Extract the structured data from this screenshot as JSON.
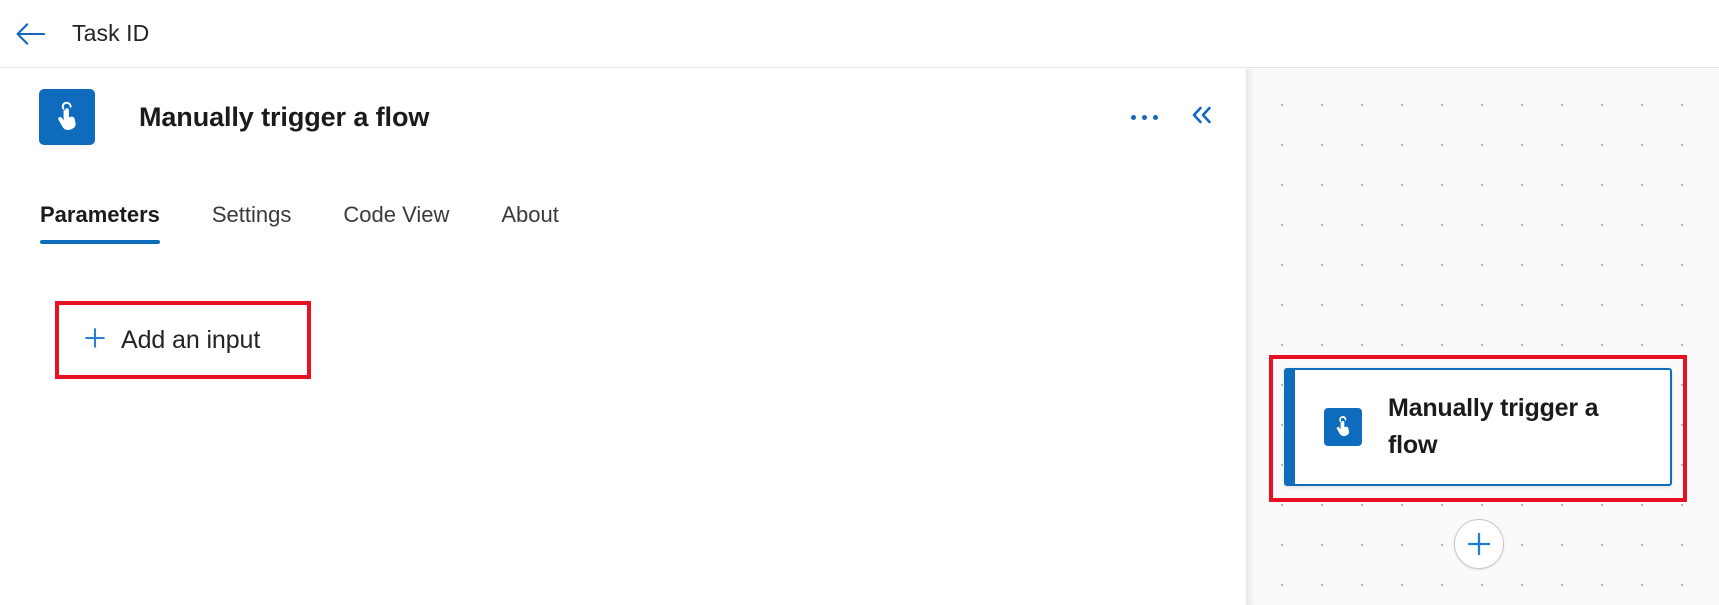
{
  "topbar": {
    "back_icon": "arrow-left-icon",
    "title": "Task ID"
  },
  "panel": {
    "icon": "manual-trigger-hand-icon",
    "title": "Manually trigger a flow",
    "more_options_icon": "ellipsis-icon",
    "collapse_icon": "double-chevron-left-icon",
    "tabs": [
      {
        "label": "Parameters",
        "active": true
      },
      {
        "label": "Settings",
        "active": false
      },
      {
        "label": "Code View",
        "active": false
      },
      {
        "label": "About",
        "active": false
      }
    ],
    "add_input": {
      "label": "Add an input",
      "icon": "plus-icon"
    }
  },
  "canvas": {
    "node": {
      "icon": "manual-trigger-hand-icon",
      "label": "Manually trigger a flow"
    },
    "add_node_icon": "plus-circle-icon"
  },
  "colors": {
    "accent_blue": "#0f6cbd",
    "annotation_red": "#e81123",
    "text_primary": "#242424",
    "canvas_bg": "#fafafa"
  }
}
